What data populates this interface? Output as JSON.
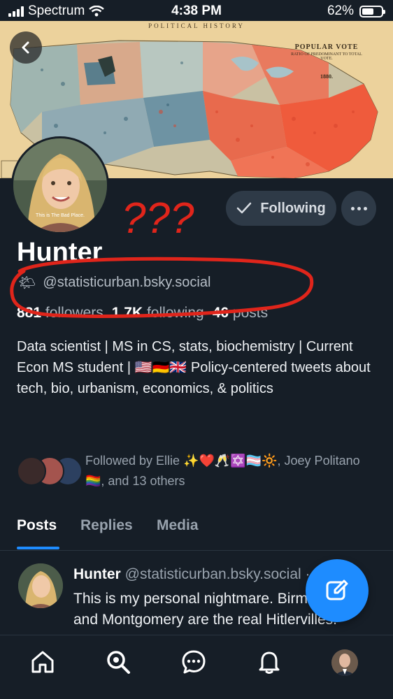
{
  "status_bar": {
    "carrier": "Spectrum",
    "time": "4:38 PM",
    "battery": "62%",
    "battery_level": 0.62
  },
  "banner": {
    "header_text": "POLITICAL HISTORY",
    "legend_title": "POPULAR VOTE",
    "legend_sub": "RATIO OF PREDOMINANT TO TOTAL VOTE.",
    "legend_year": "1880."
  },
  "avatar": {
    "caption": "This is The Bad Place."
  },
  "actions": {
    "following_label": "Following"
  },
  "profile": {
    "name": "Hunter",
    "handle_emoji": "🌤",
    "handle": "@statisticurban.bsky.social",
    "followers_count": "881",
    "followers_label": "followers",
    "following_count": "1.7K",
    "following_label": "following",
    "posts_count": "46",
    "posts_label": "posts",
    "bio": "Data scientist  |  MS in CS, stats, biochemistry  |  Current Econ MS student  |  🇺🇸🇩🇪🇬🇧 Policy-centered tweets about tech, bio, urbanism, economics, & politics"
  },
  "followed_by": {
    "text": "Followed by Ellie ✨❤️🥂✡️🏳️‍⚧️🔆, Joey Politano🏳️‍🌈, and 13 others"
  },
  "tabs": [
    {
      "label": "Posts"
    },
    {
      "label": "Replies"
    },
    {
      "label": "Media"
    }
  ],
  "post": {
    "author": "Hunter",
    "handle": "@statisticurban.bsky.social · 1m",
    "text": "This is my personal nightmare. Birmingham and Montgomery are the real Hitlervilles. Montgomery"
  },
  "annotation": {
    "text": "???"
  },
  "colors": {
    "background": "#161e27",
    "accent": "#1e8cff",
    "annotation": "#e0251b"
  }
}
